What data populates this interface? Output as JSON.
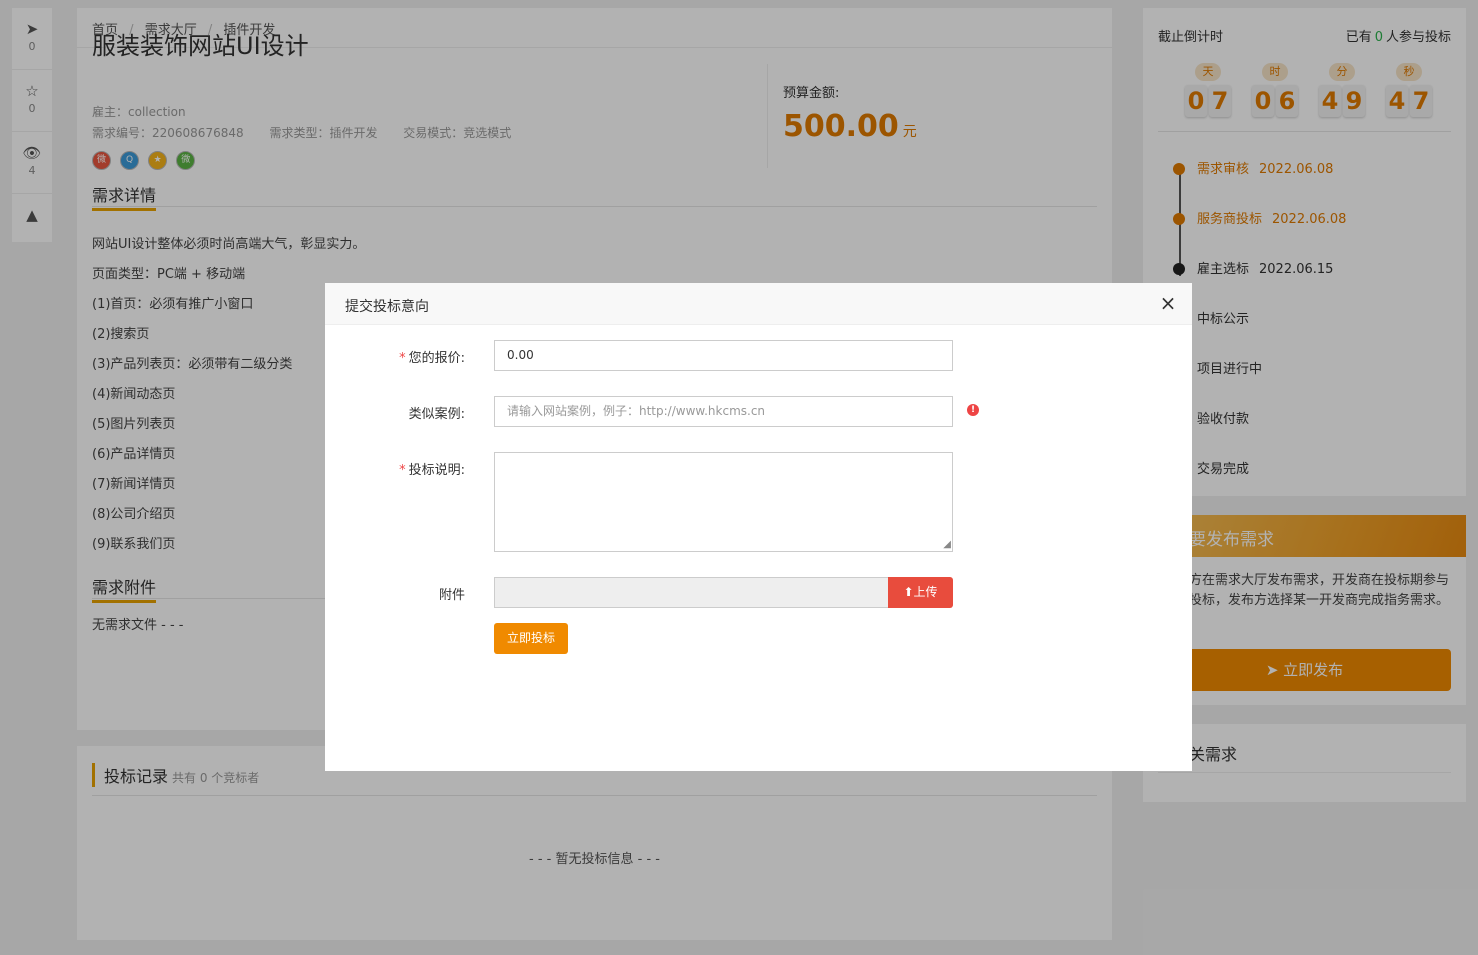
{
  "toolbar": [
    {
      "icon": "paper-plane-icon",
      "glyph": "➤",
      "count": "0"
    },
    {
      "icon": "star-icon",
      "glyph": "☆",
      "count": "0"
    },
    {
      "icon": "eye-icon",
      "glyph": "👁",
      "count": "4"
    },
    {
      "icon": "warning-icon",
      "glyph": "▲",
      "count": ""
    }
  ],
  "breadcrumb": {
    "home": "首页",
    "hall": "需求大厅",
    "category": "插件开发",
    "separator": "/"
  },
  "demand": {
    "title": "服装装饰网站UI设计",
    "employer": "雇主：collection",
    "number": "需求编号：220608676848",
    "type": "需求类型：插件开发",
    "mode": "交易模式：竞选模式",
    "budget_label": "预算金额:",
    "budget_amount": "500.00",
    "budget_unit": "元"
  },
  "share_icons": [
    "weibo-icon",
    "qq-icon",
    "qzone-icon",
    "wechat-icon"
  ],
  "detail": {
    "heading": "需求详情",
    "lines": [
      "网站UI设计整体必须时尚高端大气，彰显实力。",
      "页面类型：PC端 + 移动端",
      "(1)首页：必须有推广小窗口",
      "(2)搜索页",
      "(3)产品列表页：必须带有二级分类",
      "(4)新闻动态页",
      "(5)图片列表页",
      "(6)产品详情页",
      "(7)新闻详情页",
      "(8)公司介绍页",
      "(9)联系我们页"
    ]
  },
  "attachments": {
    "heading": "需求附件",
    "empty": "无需求文件 - - -"
  },
  "records": {
    "title": "投标记录",
    "summary": "共有 0 个竞标者",
    "empty": "- - - 暂无投标信息 - - -"
  },
  "countdown": {
    "label": "截止倒计时",
    "participants_prefix": "已有",
    "participants": "0",
    "participants_suffix": "人参与投标",
    "units": [
      {
        "label": "天",
        "digits": [
          "0",
          "7"
        ]
      },
      {
        "label": "时",
        "digits": [
          "0",
          "6"
        ]
      },
      {
        "label": "分",
        "digits": [
          "4",
          "9"
        ]
      },
      {
        "label": "秒",
        "digits": [
          "4",
          "7"
        ]
      }
    ]
  },
  "timeline": [
    {
      "label": "需求审核",
      "date": "2022.06.08",
      "state": "done"
    },
    {
      "label": "服务商投标",
      "date": "2022.06.08",
      "state": "done"
    },
    {
      "label": "雇主选标",
      "date": "2022.06.15",
      "state": "active"
    },
    {
      "label": "中标公示",
      "date": "",
      "state": "pend"
    },
    {
      "label": "项目进行中",
      "date": "",
      "state": "pend"
    },
    {
      "label": "验收付款",
      "date": "",
      "state": "pend"
    },
    {
      "label": "交易完成",
      "date": "",
      "state": "pend"
    }
  ],
  "publish": {
    "banner": "要发布需求",
    "text": "方在需求大厅发布需求，开发商在投标期参与投标，发布方选择某一开发商完成指务需求。",
    "button": "立即发布",
    "button_icon": "➤"
  },
  "related": {
    "title": "关需求"
  },
  "modal": {
    "title": "提交投标意向",
    "close": "×",
    "price_label": "您的报价:",
    "price_value": "0.00",
    "case_label": "类似案例:",
    "case_placeholder": "请输入网站案例，例子：http://www.hkcms.cn",
    "desc_label": "投标说明:",
    "attach_label": "附件",
    "upload_button": "上传",
    "upload_icon": "⬆",
    "submit_button": "立即投标",
    "required_mark": "*",
    "warning_glyph": "!"
  },
  "colors": {
    "accent": "#f08a00",
    "upload": "#e84c3d",
    "underline": "#e8a300",
    "green": "#2bb24c"
  }
}
